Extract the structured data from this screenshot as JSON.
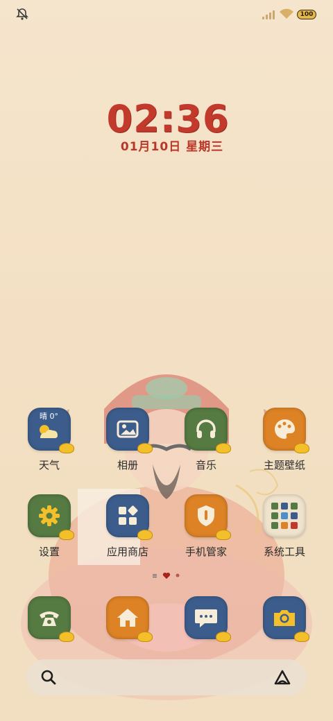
{
  "status_bar": {
    "left_icon": "notification-muted-icon",
    "battery_level": "100"
  },
  "lockclock": {
    "time": "02:36",
    "date": "01月10日 星期三"
  },
  "weather_widget": {
    "text": "晴 0°"
  },
  "apps": [
    {
      "label": "天气",
      "icon": "weather-icon",
      "color": "#3c5d8c"
    },
    {
      "label": "相册",
      "icon": "gallery-icon",
      "color": "#3c5d8c"
    },
    {
      "label": "音乐",
      "icon": "headphones-icon",
      "color": "#557a42"
    },
    {
      "label": "主题壁纸",
      "icon": "palette-icon",
      "color": "#dd8326"
    },
    {
      "label": "设置",
      "icon": "gear-icon",
      "color": "#557a42"
    },
    {
      "label": "应用商店",
      "icon": "app-store-icon",
      "color": "#3c5d8c"
    },
    {
      "label": "手机管家",
      "icon": "shield-icon",
      "color": "#dd8326"
    },
    {
      "label": "系统工具",
      "icon": "folder-icon",
      "color": "#efe3cd"
    }
  ],
  "dock": [
    {
      "icon": "phone-icon",
      "color": "#557a42"
    },
    {
      "icon": "home-icon",
      "color": "#dd8326"
    },
    {
      "icon": "message-icon",
      "color": "#3c5d8c"
    },
    {
      "icon": "camera-icon",
      "color": "#3c5d8c"
    }
  ],
  "search_bar": {
    "left_icon": "search-icon",
    "right_icon": "assistant-icon"
  }
}
